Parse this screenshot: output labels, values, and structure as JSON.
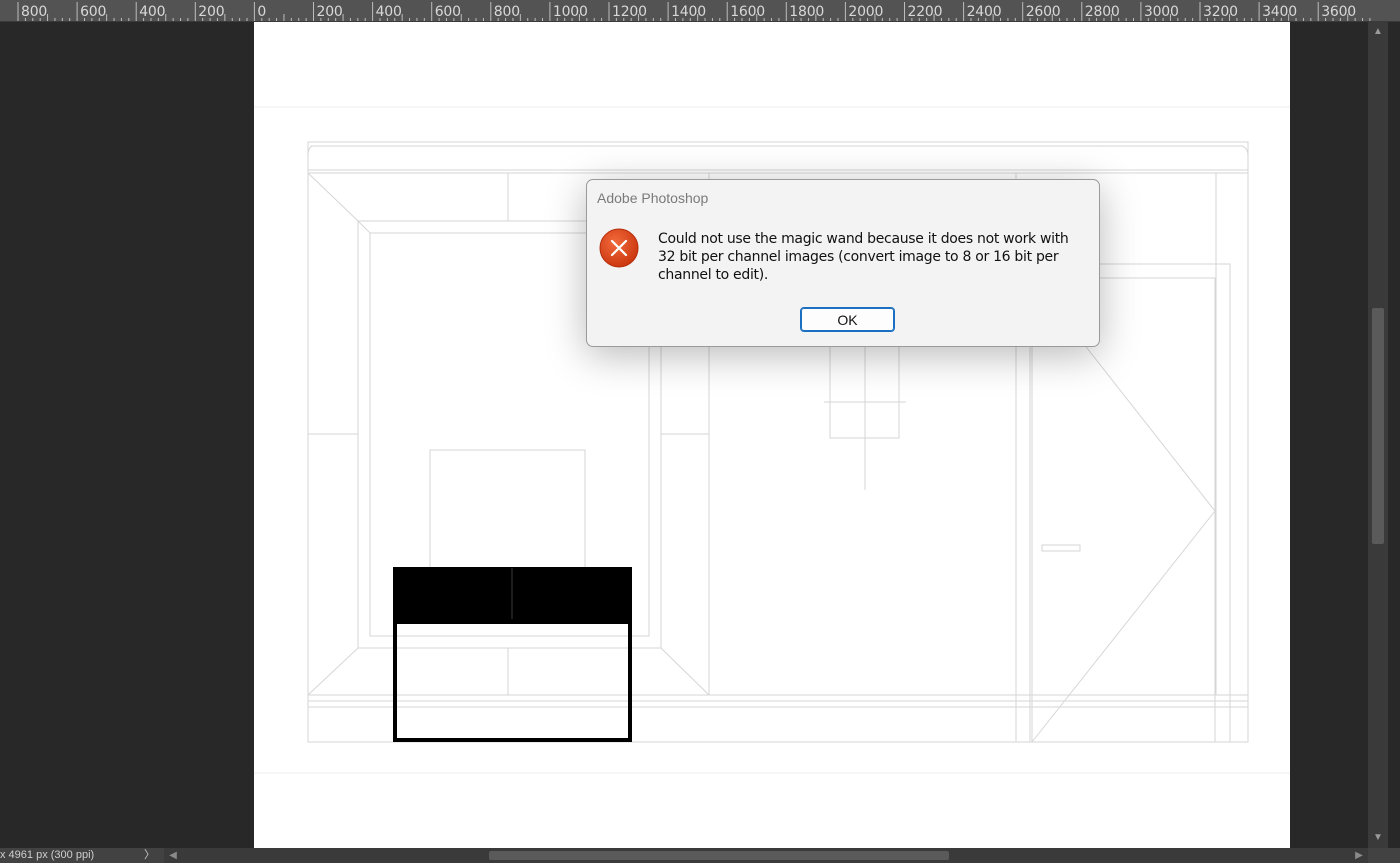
{
  "ruler": {
    "labels": [
      "800",
      "600",
      "400",
      "200",
      "0",
      "200",
      "400",
      "600",
      "800",
      "1000",
      "1200",
      "1400",
      "1600",
      "1800",
      "2000",
      "2200",
      "2400",
      "2600",
      "2800",
      "3000",
      "3200",
      "3400",
      "3600"
    ]
  },
  "status": {
    "text": "x 4961 px (300 ppi)",
    "arrow": "〉"
  },
  "dialog": {
    "title": "Adobe Photoshop",
    "message": "Could not use the magic wand because it does not work with 32 bit per channel images (convert image to 8 or 16 bit per channel to edit).",
    "ok_label": "OK",
    "icon": "error-icon",
    "icon_color": "#e04a1b"
  },
  "colors": {
    "workspace": "#282828",
    "canvas": "#ffffff",
    "ruler": "#535353"
  }
}
